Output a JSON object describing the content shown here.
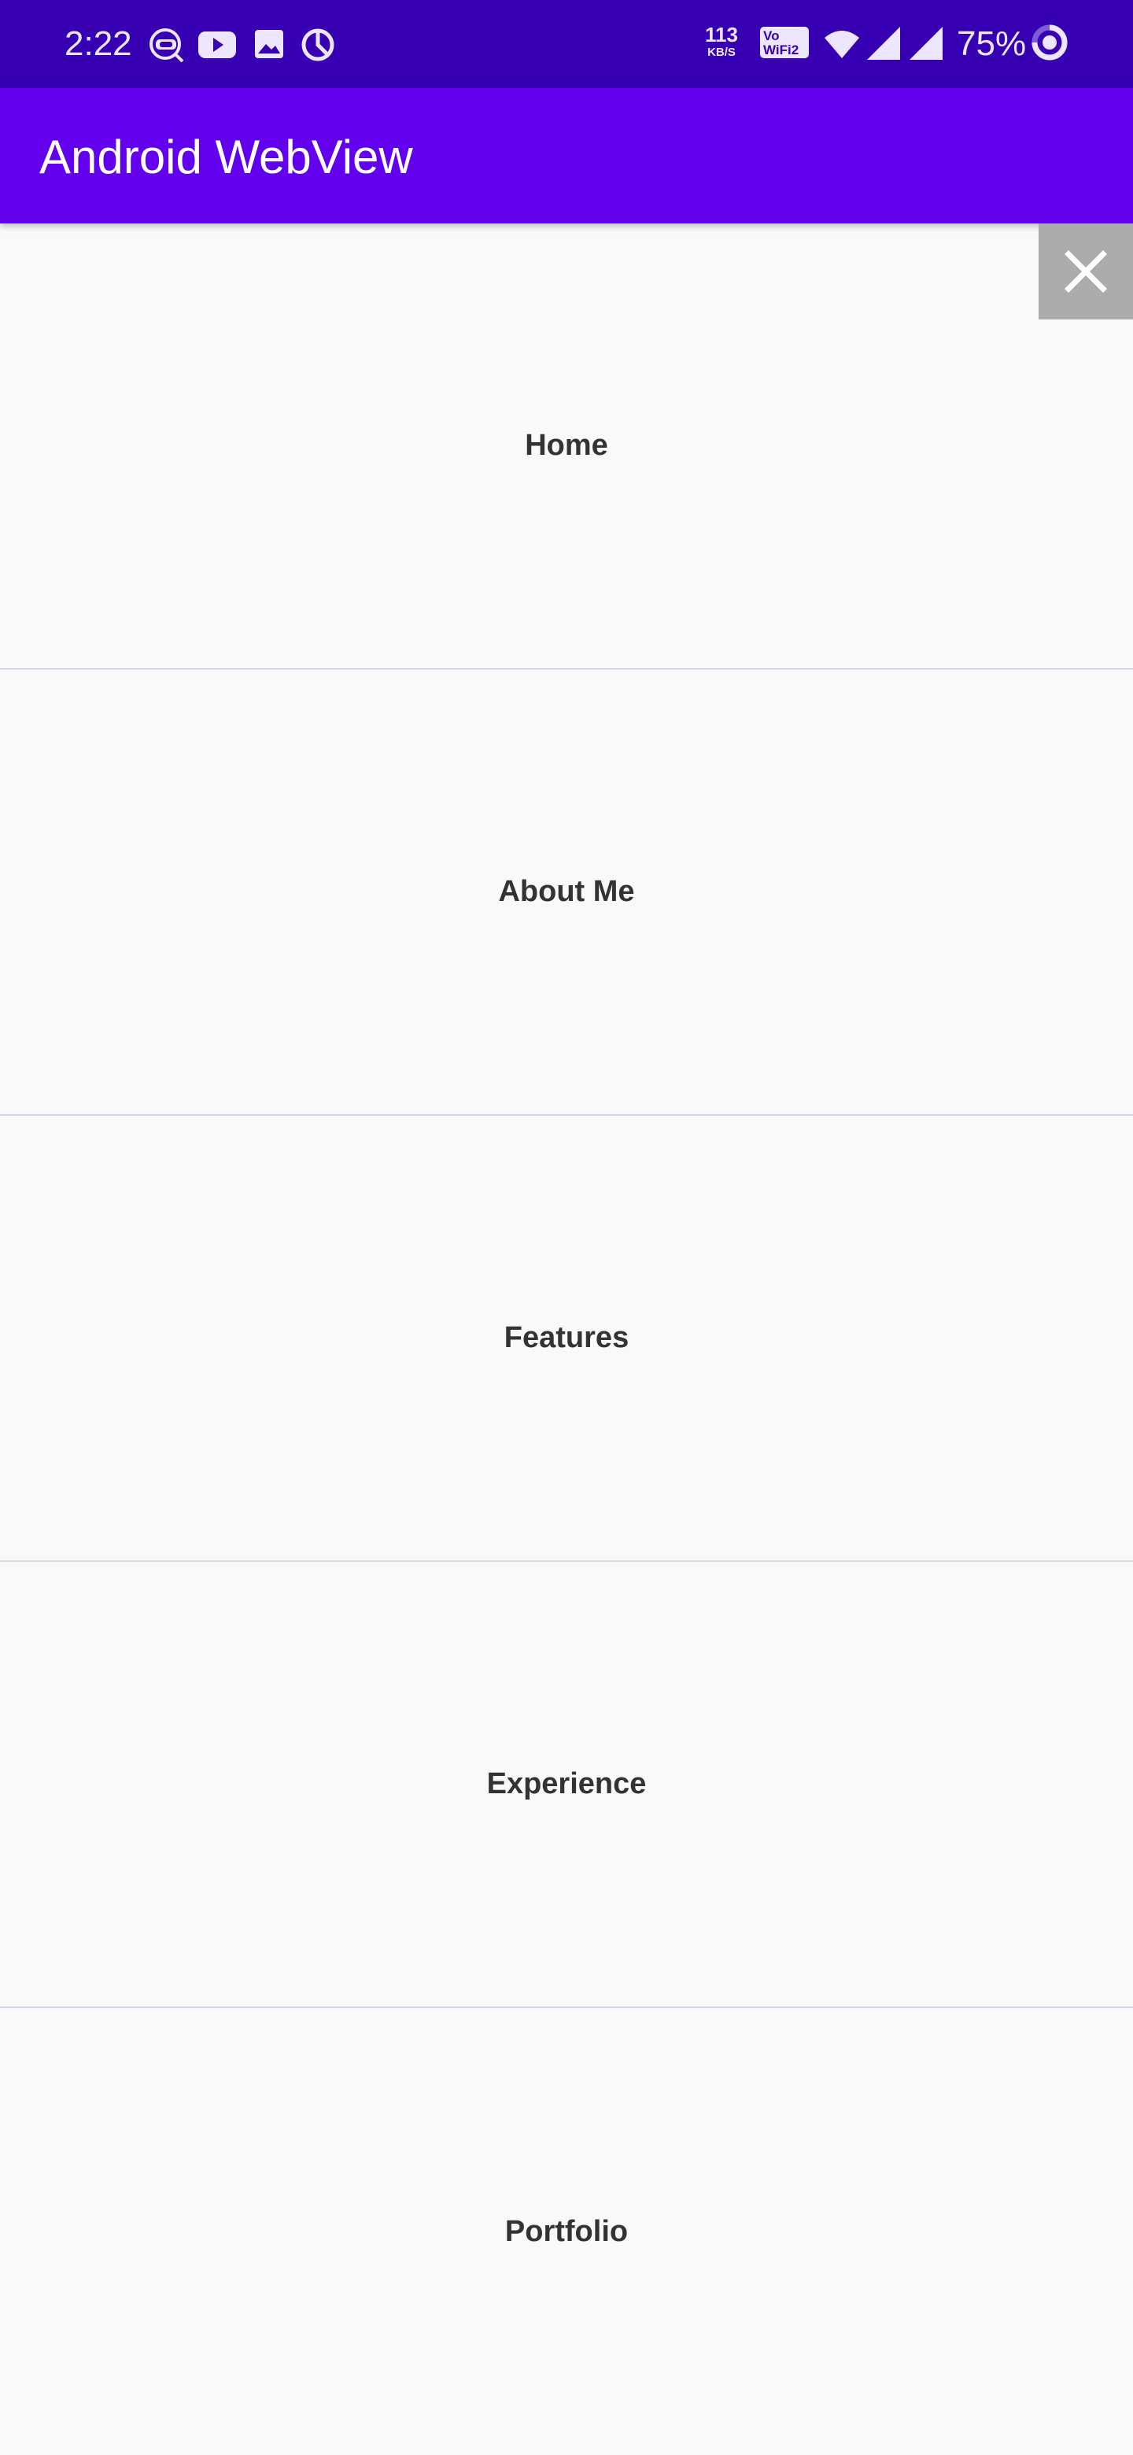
{
  "status_bar": {
    "time": "2:22",
    "network_speed_value": "113",
    "network_speed_unit": "KB/S",
    "vowifi_line1": "Vo",
    "vowifi_line2": "WiFi",
    "vowifi_sim": "2",
    "battery_percent": "75%",
    "icons": [
      "vpn-key-icon",
      "youtube-icon",
      "image-icon",
      "data-saver-icon",
      "wifi-icon",
      "signal-icon",
      "signal-icon-2",
      "battery-icon"
    ]
  },
  "app_bar": {
    "title": "Android WebView"
  },
  "sections": [
    {
      "label": "Home"
    },
    {
      "label": "About Me"
    },
    {
      "label": "Features"
    },
    {
      "label": "Experience"
    },
    {
      "label": "Portfolio"
    }
  ],
  "close_button": {
    "icon": "close-icon"
  },
  "colors": {
    "status_bar": "#3700b3",
    "app_bar": "#6200ee",
    "content_bg": "#f9f9f9",
    "divider": "#d4d4ea",
    "close_button_bg": "#acacac"
  }
}
